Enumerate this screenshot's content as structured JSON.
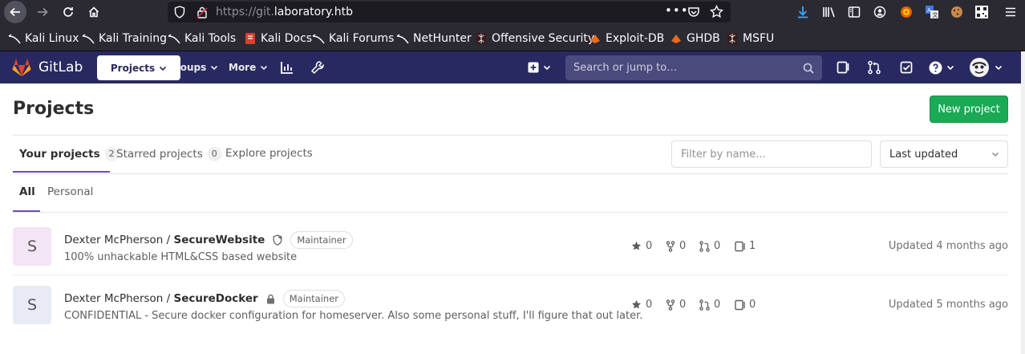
{
  "browser": {
    "url_prefix": "https://git.",
    "url_domain": "laboratory.htb",
    "bookmarks": [
      {
        "label": "Kali Linux",
        "icon": "kali-icon"
      },
      {
        "label": "Kali Training",
        "icon": "kali-icon"
      },
      {
        "label": "Kali Tools",
        "icon": "kali-icon"
      },
      {
        "label": "Kali Docs",
        "icon": "kali-docs-icon"
      },
      {
        "label": "Kali Forums",
        "icon": "kali-icon"
      },
      {
        "label": "NetHunter",
        "icon": "kali-icon"
      },
      {
        "label": "Offensive Security",
        "icon": "offsec-icon"
      },
      {
        "label": "Exploit-DB",
        "icon": "exploitdb-icon"
      },
      {
        "label": "GHDB",
        "icon": "exploitdb-icon"
      },
      {
        "label": "MSFU",
        "icon": "offsec-icon"
      }
    ]
  },
  "gitlab_nav": {
    "brand": "GitLab",
    "projects": "Projects",
    "groups": "Groups",
    "more": "More",
    "search_placeholder": "Search or jump to…"
  },
  "page": {
    "title": "Projects",
    "new_project": "New project",
    "tabs": [
      {
        "label": "Your projects",
        "count": "2"
      },
      {
        "label": "Starred projects",
        "count": "0"
      },
      {
        "label": "Explore projects"
      }
    ],
    "filter_placeholder": "Filter by name...",
    "sort_label": "Last updated",
    "subtabs": [
      "All",
      "Personal"
    ]
  },
  "projects": [
    {
      "avatar_letter": "S",
      "namespace": "Dexter McPherson / ",
      "name": "SecureWebsite",
      "visibility_icon": "shield-icon",
      "role": "Maintainer",
      "description": "100% unhackable HTML&CSS based website",
      "stars": "0",
      "forks": "0",
      "merge_requests": "0",
      "issues": "1",
      "updated": "Updated 4 months ago"
    },
    {
      "avatar_letter": "S",
      "namespace": "Dexter McPherson / ",
      "name": "SecureDocker",
      "visibility_icon": "lock-icon",
      "role": "Maintainer",
      "description": "CONFIDENTIAL - Secure docker configuration for homeserver. Also some personal stuff, I'll figure that out later.",
      "stars": "0",
      "forks": "0",
      "merge_requests": "0",
      "issues": "0",
      "updated": "Updated 5 months ago"
    }
  ],
  "colors": {
    "nav_bg": "#292961",
    "accent": "#6b4fbb",
    "new_project_green": "#1aaa55"
  }
}
